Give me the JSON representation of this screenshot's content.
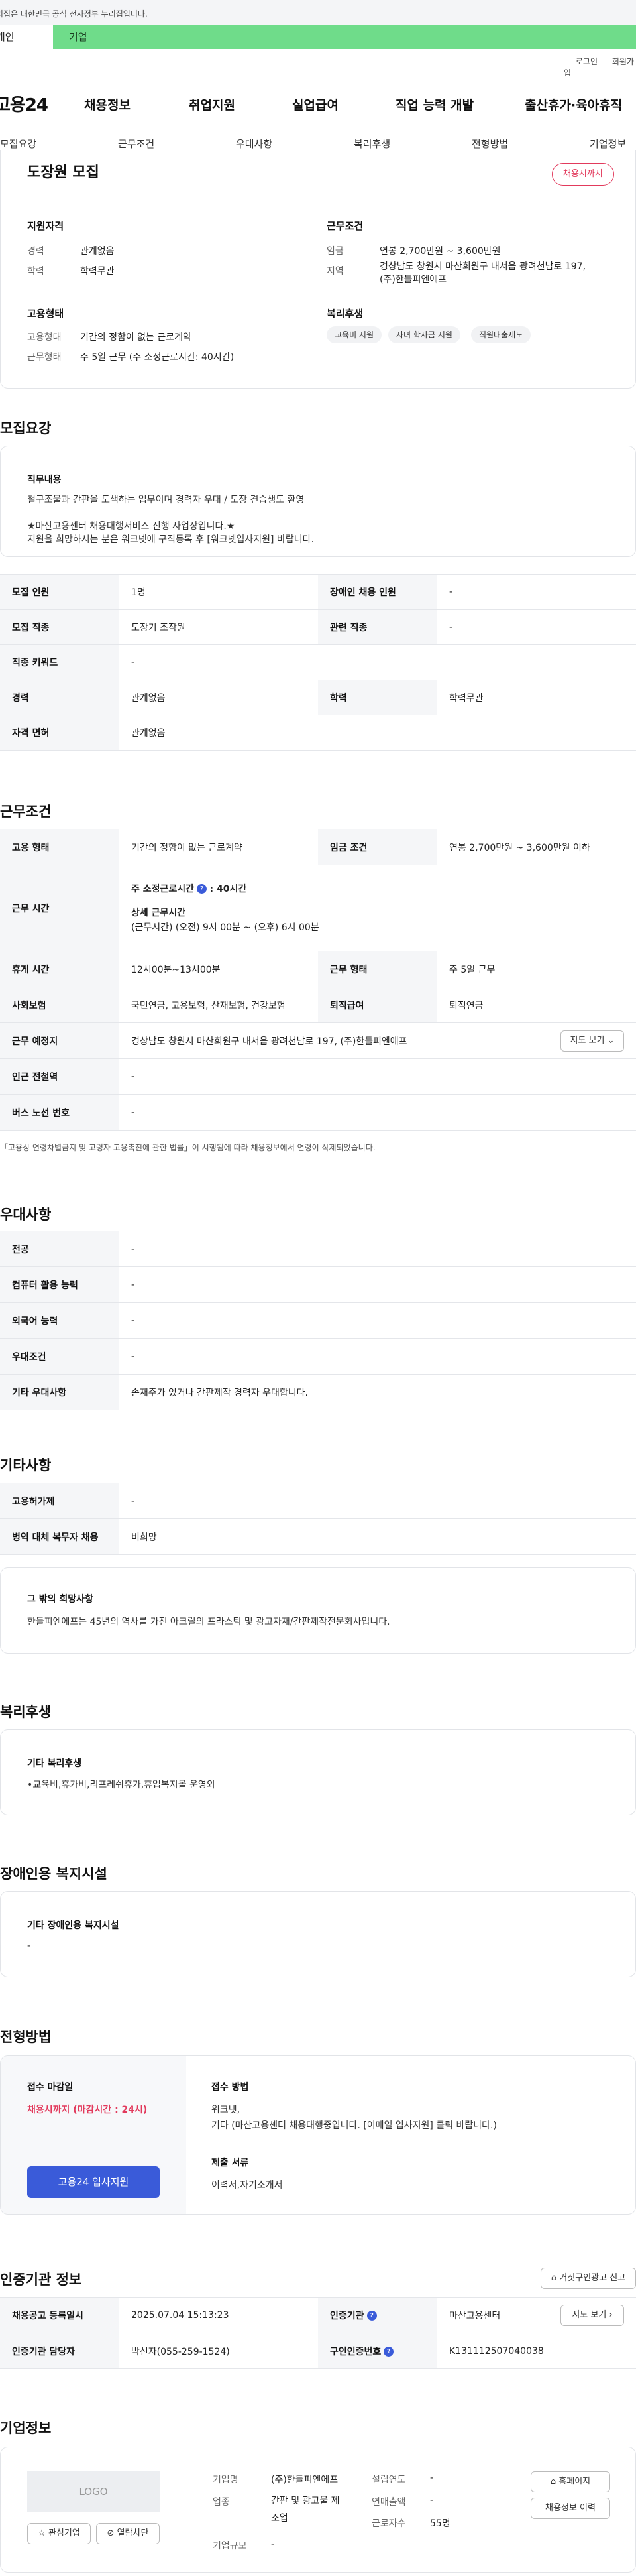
{
  "gov_banner": {
    "text": "이 누리집은 대한민국 공식 전자정부 누리집입니다."
  },
  "user_tabs": {
    "personal": "개인",
    "company": "기업"
  },
  "top_links": {
    "login": "로그인",
    "signup": "회원가입"
  },
  "gnb": {
    "logo": "고용24",
    "menu": [
      "채용정보",
      "취업지원",
      "실업급여",
      "직업 능력 개발",
      "출산휴가·육아휴직"
    ]
  },
  "subnav": [
    "모집요강",
    "근무조건",
    "우대사항",
    "복리후생",
    "전형방법",
    "기업정보"
  ],
  "summary": {
    "title": "도장원 모집",
    "status_badge": "채용시까지",
    "qual_heading": "지원자격",
    "career_label": "경력",
    "career_value": "관계없음",
    "edu_label": "학력",
    "edu_value": "학력무관",
    "cond_heading": "근무조건",
    "wage_label": "임금",
    "wage_value": "연봉 2,700만원 ~ 3,600만원",
    "region_label": "지역",
    "region_value": "경상남도 창원시 마산회원구 내서읍 광려천남로 197, (주)한들피엔에프",
    "emp_heading": "고용형태",
    "emptype_label": "고용형태",
    "emptype_value": "기간의 정함이 없는 근로계약",
    "worktype_label": "근무형태",
    "worktype_value": "주 5일 근무 (주 소정근로시간: 40시간)",
    "welfare_heading": "복리후생",
    "welfare_chips": [
      "교육비 지원",
      "자녀 학자금 지원",
      "직원대출제도"
    ]
  },
  "recruit": {
    "heading": "모집요강",
    "duty_heading": "직무내용",
    "duty_line1": "철구조물과 간판을 도색하는 업무이며 경력자 우대 / 도장 견습생도 환영",
    "duty_line2": "★마산고용센터 채용대행서비스 진행 사업장입니다.★",
    "duty_line3": "지원을 희망하시는 분은 워크넷에 구직등록 후 [워크넷입사지원] 바랍니다.",
    "rows": [
      {
        "l1": "모집 인원",
        "v1": "1명",
        "l2": "장애인 채용 인원",
        "v2": "-"
      },
      {
        "l1": "모집 직종",
        "v1": "도장기 조작원",
        "l2": "관련 직종",
        "v2": "-"
      },
      {
        "l1": "직종 키워드",
        "v1": "-"
      },
      {
        "l1": "경력",
        "v1": "관계없음",
        "l2": "학력",
        "v2": "학력무관"
      },
      {
        "l1": "자격 면허",
        "v1": "관계없음"
      }
    ]
  },
  "conditions": {
    "heading": "근무조건",
    "emp_label": "고용 형태",
    "emp_value": "기간의 정함이 없는 근로계약",
    "wage_label": "임금 조건",
    "wage_value": "연봉 2,700만원 ~ 3,600만원 이하",
    "time_label": "근무 시간",
    "time_weekly": "주 소정근로시간",
    "time_weekly_value": ": 40시간",
    "time_detail_heading": "상세 근무시간",
    "time_detail": "(근무시간) (오전) 9시 00분 ~ (오후) 6시 00분",
    "break_label": "휴게 시간",
    "break_value": "12시00분~13시00분",
    "worktype_label": "근무 형태",
    "worktype_value": "주 5일 근무",
    "insurance_label": "사회보험",
    "insurance_value": "국민연금, 고용보험, 산재보험, 건강보험",
    "retire_label": "퇴직급여",
    "retire_value": "퇴직연금",
    "place_label": "근무 예정지",
    "place_value": "경상남도 창원시 마산회원구 내서읍 광려천남로 197, (주)한들피엔에프",
    "map_button": "지도 보기",
    "station_label": "인근 전철역",
    "station_value": "-",
    "bus_label": "버스 노선 번호",
    "bus_value": "-",
    "note": "「고용상 연령차별금지 및 고령자 고용촉진에 관한 법률」이 시행됨에 따라 채용정보에서 연령이 삭제되었습니다."
  },
  "preference": {
    "heading": "우대사항",
    "rows": [
      {
        "label": "전공",
        "value": "-"
      },
      {
        "label": "컴퓨터 활용 능력",
        "value": "-"
      },
      {
        "label": "외국어 능력",
        "value": "-"
      },
      {
        "label": "우대조건",
        "value": "-"
      },
      {
        "label": "기타 우대사항",
        "value": "손재주가 있거나 간판제작 경력자 우대합니다."
      }
    ]
  },
  "other": {
    "heading": "기타사항",
    "rows": [
      {
        "label": "고용허가제",
        "value": "-"
      },
      {
        "label": "병역 대체 복무자 채용",
        "value": "비희망"
      }
    ],
    "wish_heading": "그 밖의 희망사항",
    "wish_text": "한들피엔에프는 45년의 역사를 가진 아크릴의 프라스틱 및 광고자재/간판제작전문회사입니다."
  },
  "welfare": {
    "heading": "복리후생",
    "sub_heading": "기타 복리후생",
    "text": "•교육비,휴가비,리프레쉬휴가,휴업복지몰 운영외"
  },
  "disability": {
    "heading": "장애인용 복지시설",
    "sub_heading": "기타 장애인용 복지시설",
    "text": "-"
  },
  "screening": {
    "heading": "전형방법",
    "deadline_heading": "접수 마감일",
    "deadline_value": "채용시까지 (마감시간 : 24시)",
    "apply_button": "고용24 입사지원",
    "method_heading": "접수 방법",
    "method_line1": "워크넷,",
    "method_line2": "기타 (마산고용센터 채용대행중입니다. [이메일 입사지원] 클릭 바랍니다.)",
    "docs_heading": "제출 서류",
    "docs_value": "이력서,자기소개서"
  },
  "cert": {
    "heading": "인증기관 정보",
    "report_button": "거짓구인광고 신고",
    "rows": [
      {
        "l1": "채용공고 등록일시",
        "v1": "2025.07.04 15:13:23",
        "l2": "인증기관",
        "v2": "마산고용센터",
        "btn": "지도 보기"
      },
      {
        "l1": "인증기관 담당자",
        "v1": "박선자(055-259-1524)",
        "l2": "구인인증번호",
        "v2": "K131112507040038"
      }
    ]
  },
  "company": {
    "heading": "기업정보",
    "logo_text": "LOGO",
    "fav_button": "관심기업",
    "block_button": "열람차단",
    "name_label": "기업명",
    "name_value": "(주)한들피엔에프",
    "industry_label": "업종",
    "industry_value": "간판 및 광고물 제조업",
    "size_label": "기업규모",
    "size_value": "-",
    "founded_label": "설립연도",
    "founded_value": "-",
    "sales_label": "연매출액",
    "sales_value": "-",
    "employees_label": "근로자수",
    "employees_value": "55명",
    "homepage_button": "홈페이지",
    "jobs_button": "채용정보 이력"
  }
}
